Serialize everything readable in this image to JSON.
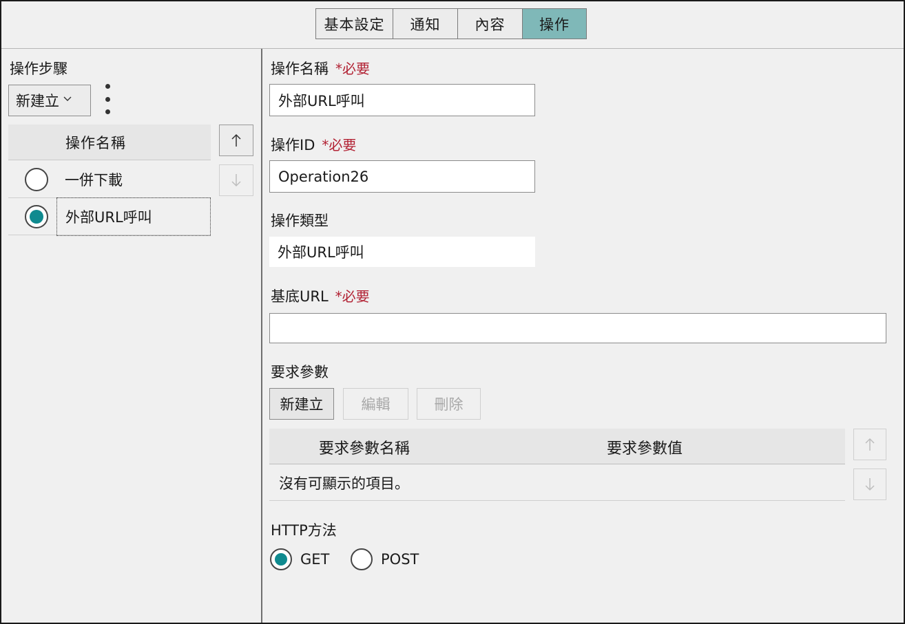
{
  "tabs": [
    {
      "label": "基本設定",
      "active": false
    },
    {
      "label": "通知",
      "active": false
    },
    {
      "label": "內容",
      "active": false
    },
    {
      "label": "操作",
      "active": true
    }
  ],
  "left": {
    "section_title": "操作步驟",
    "new_dropdown": "新建立",
    "list_header": "操作名稱",
    "items": [
      {
        "label": "一併下載",
        "selected": false
      },
      {
        "label": "外部URL呼叫",
        "selected": true
      }
    ]
  },
  "form": {
    "name_label": "操作名稱",
    "required_mark": "*必要",
    "name_value": "外部URL呼叫",
    "id_label": "操作ID",
    "id_value": "Operation26",
    "type_label": "操作類型",
    "type_value": "外部URL呼叫",
    "base_url_label": "基底URL",
    "base_url_value": "",
    "params_title": "要求參數",
    "buttons": {
      "new": "新建立",
      "edit": "編輯",
      "delete": "刪除"
    },
    "params_table": {
      "col_name": "要求參數名稱",
      "col_value": "要求參數值",
      "empty": "沒有可顯示的項目。"
    },
    "http_method_label": "HTTP方法",
    "methods": [
      {
        "label": "GET",
        "selected": true
      },
      {
        "label": "POST",
        "selected": false
      }
    ]
  },
  "colors": {
    "accent": "#0f8a8f",
    "active_tab": "#7fb8b8",
    "required": "#b22234"
  }
}
